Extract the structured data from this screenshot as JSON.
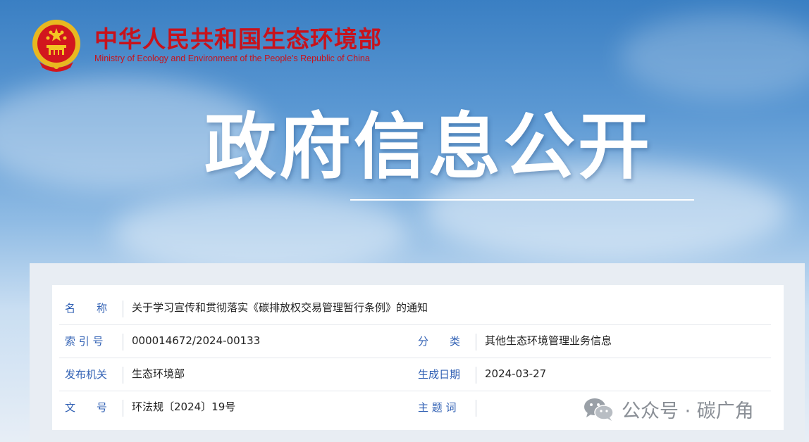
{
  "header": {
    "ministry_cn": "中华人民共和国生态环境部",
    "ministry_en": "Ministry of Ecology and Environment of the People's Republic of China",
    "emblem_icon": "national-emblem-icon",
    "brand_color": "#c8121b"
  },
  "banner": {
    "title": "政府信息公开"
  },
  "info": {
    "name_label": "名　　称",
    "name_value": "关于学习宣传和贯彻落实《碳排放权交易管理暂行条例》的通知",
    "index_label": "索 引 号",
    "index_value": "000014672/2024-00133",
    "category_label": "分　　类",
    "category_value": "其他生态环境管理业务信息",
    "issuer_label": "发布机关",
    "issuer_value": "生态环境部",
    "date_label": "生成日期",
    "date_value": "2024-03-27",
    "docno_label": "文　　号",
    "docno_value": "环法规〔2024〕19号",
    "topic_label": "主 题 词",
    "topic_value": "",
    "label_color": "#2f5fb3"
  },
  "watermark": {
    "text": "公众号 · 碳广角",
    "icon": "wechat-icon"
  }
}
